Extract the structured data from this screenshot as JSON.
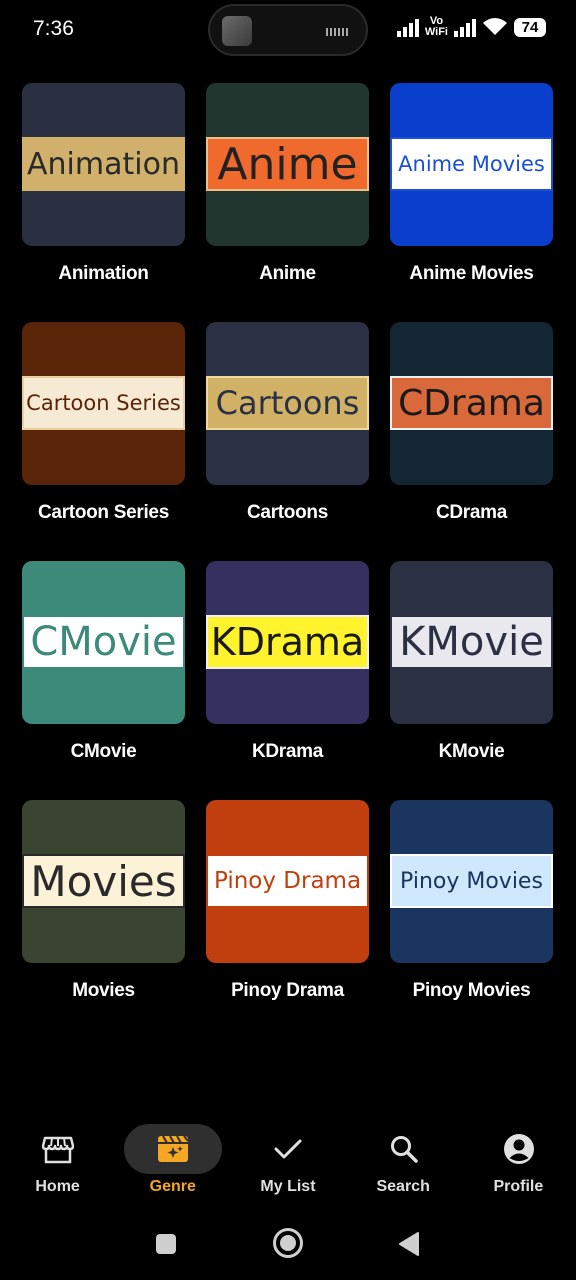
{
  "status_bar": {
    "time": "7:36",
    "network_label_top": "Vo",
    "network_label_bottom": "WiFi",
    "battery": "74"
  },
  "genres": [
    {
      "label": "Animation",
      "banner": "Animation",
      "tile_bg": "#2a3042",
      "banner_bg": "#d0b06a",
      "banner_fg": "#2a2a2a",
      "banner_border": "#d0b06a",
      "font_size": 30
    },
    {
      "label": "Anime",
      "banner": "Anime",
      "tile_bg": "#223630",
      "banner_bg": "#f06a2e",
      "banner_fg": "#222222",
      "banner_border": "#e8c08a",
      "font_size": 44
    },
    {
      "label": "Anime Movies",
      "banner": "Anime Movies",
      "tile_bg": "#0a3fcc",
      "banner_bg": "#ffffff",
      "banner_fg": "#1a4fd6",
      "banner_border": "#1a4fd6",
      "font_size": 21
    },
    {
      "label": "Cartoon Series",
      "banner": "Cartoon Series",
      "tile_bg": "#5a2408",
      "banner_bg": "#f7ead5",
      "banner_fg": "#5a2408",
      "banner_border": "#e8cfa0",
      "font_size": 21
    },
    {
      "label": "Cartoons",
      "banner": "Cartoons",
      "tile_bg": "#2b3144",
      "banner_bg": "#d1b165",
      "banner_fg": "#2b3144",
      "banner_border": "#f0d89a",
      "font_size": 32
    },
    {
      "label": "CDrama",
      "banner": "CDrama",
      "tile_bg": "#132634",
      "banner_bg": "#d9683a",
      "banner_fg": "#1a1a1a",
      "banner_border": "#eeeeee",
      "font_size": 36
    },
    {
      "label": "CMovie",
      "banner": "CMovie",
      "tile_bg": "#3b8a7a",
      "banner_bg": "#ffffff",
      "banner_fg": "#3b8a7a",
      "banner_border": "#3b8a7a",
      "font_size": 40
    },
    {
      "label": "KDrama",
      "banner": "KDrama",
      "tile_bg": "#353060",
      "banner_bg": "#fff32e",
      "banner_fg": "#1a1a1a",
      "banner_border": "#eeeeee",
      "font_size": 38
    },
    {
      "label": "KMovie",
      "banner": "KMovie",
      "tile_bg": "#2b3042",
      "banner_bg": "#e8e8ee",
      "banner_fg": "#2b3042",
      "banner_border": "#2b3042",
      "font_size": 40
    },
    {
      "label": "Movies",
      "banner": "Movies",
      "tile_bg": "#3a4430",
      "banner_bg": "#fbf2d8",
      "banner_fg": "#2a2a2a",
      "banner_border": "#2a2a2a",
      "font_size": 42
    },
    {
      "label": "Pinoy Drama",
      "banner": "Pinoy Drama",
      "tile_bg": "#c13f0e",
      "banner_bg": "#ffffff",
      "banner_fg": "#c13f0e",
      "banner_border": "#c13f0e",
      "font_size": 23
    },
    {
      "label": "Pinoy Movies",
      "banner": "Pinoy Movies",
      "tile_bg": "#1a3560",
      "banner_bg": "#cfe8fb",
      "banner_fg": "#1a3560",
      "banner_border": "#ffffff",
      "font_size": 22
    }
  ],
  "bottom_nav": {
    "items": [
      {
        "label": "Home",
        "icon": "storefront-icon",
        "active": false
      },
      {
        "label": "Genre",
        "icon": "clapperboard-icon",
        "active": true
      },
      {
        "label": "My List",
        "icon": "checkmark-icon",
        "active": false
      },
      {
        "label": "Search",
        "icon": "search-icon",
        "active": false
      },
      {
        "label": "Profile",
        "icon": "profile-icon",
        "active": false
      }
    ],
    "active_color": "#f5a623"
  },
  "system_nav": {
    "recent": "recent-apps-icon",
    "home": "home-circle-icon",
    "back": "back-triangle-icon"
  }
}
